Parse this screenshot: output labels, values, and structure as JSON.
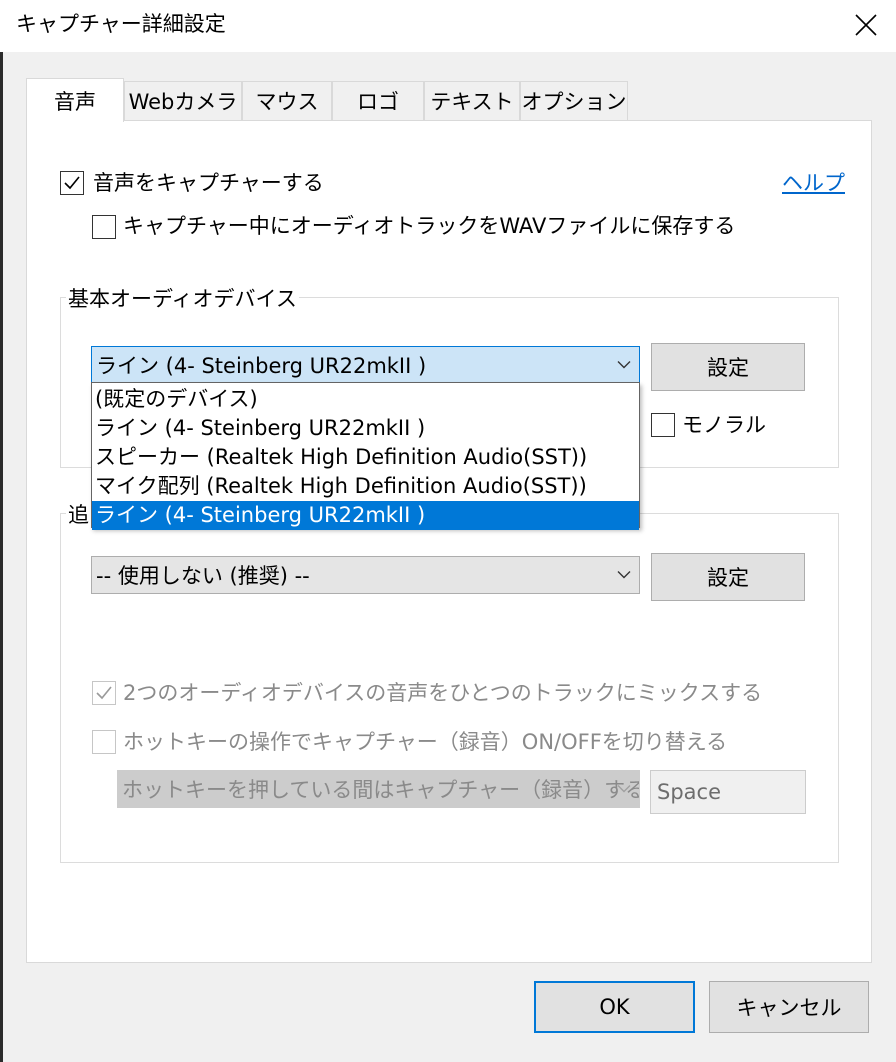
{
  "window": {
    "title": "キャプチャー詳細設定"
  },
  "tabs": [
    {
      "label": "音声",
      "active": true
    },
    {
      "label": "Webカメラ"
    },
    {
      "label": "マウス"
    },
    {
      "label": "ロゴ"
    },
    {
      "label": "テキスト"
    },
    {
      "label": "オプション"
    }
  ],
  "audio": {
    "capture_audio_label": "音声をキャプチャーする",
    "capture_audio_checked": true,
    "help_link": "ヘルプ",
    "save_wav_label": "キャプチャー中にオーディオトラックをWAVファイルに保存する",
    "save_wav_checked": false
  },
  "primary_device": {
    "legend": "基本オーディオデバイス",
    "selected": "ライン (4- Steinberg UR22mkII )",
    "settings_button": "設定",
    "mono_label": "モノラル",
    "mono_checked": false,
    "options": [
      "(既定のデバイス)",
      "ライン (4- Steinberg UR22mkII )",
      "スピーカー (Realtek High Definition Audio(SST))",
      "マイク配列 (Realtek High Definition Audio(SST))",
      "ライン (4- Steinberg UR22mkII )"
    ],
    "highlighted_index": 4
  },
  "secondary_device": {
    "legend_visible": "追",
    "selected": "-- 使用しない (推奨) --",
    "settings_button": "設定",
    "mix_label": "2つのオーディオデバイスの音声をひとつのトラックにミックスする",
    "mix_checked": true,
    "hotkey_toggle_label": "ホットキーの操作でキャプチャー（録音）ON/OFFを切り替える",
    "hotkey_toggle_checked": false,
    "hotkey_mode": "ホットキーを押している間はキャプチャー（録音）する",
    "hotkey_key": "Space"
  },
  "footer": {
    "ok": "OK",
    "cancel": "キャンセル"
  },
  "colors": {
    "accent": "#0078d7",
    "link": "#0066cc",
    "selection": "#0078d7"
  }
}
